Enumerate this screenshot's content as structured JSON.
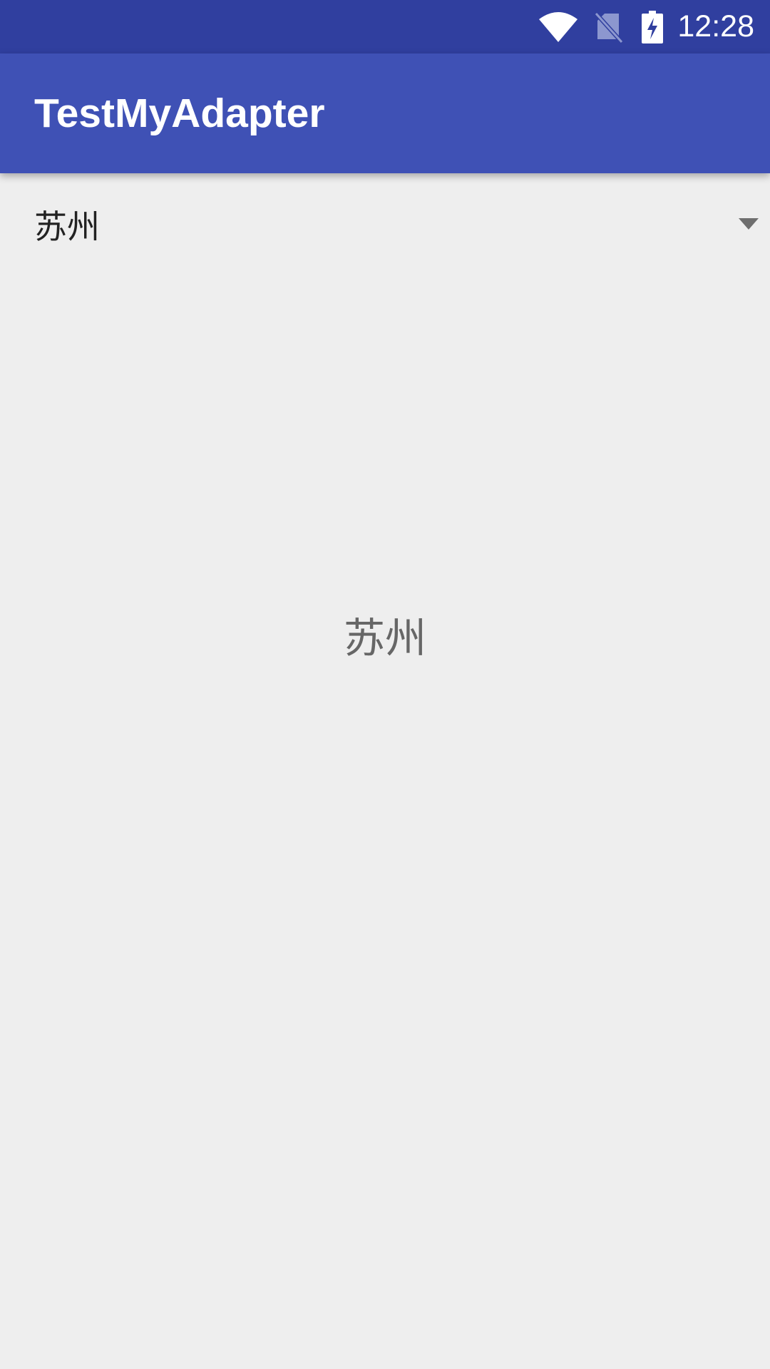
{
  "status_bar": {
    "time": "12:28",
    "icons": [
      "wifi-icon",
      "no-sim-icon",
      "battery-charging-icon"
    ]
  },
  "app_bar": {
    "title": "TestMyAdapter"
  },
  "spinner": {
    "selected_value": "苏州",
    "icon": "dropdown-arrow-icon"
  },
  "content": {
    "selected_text": "苏州"
  },
  "colors": {
    "status_bar": "#303F9F",
    "app_bar": "#3F51B5",
    "background": "#EEEEEE",
    "spinner_text": "#222222",
    "center_text": "#666666"
  }
}
